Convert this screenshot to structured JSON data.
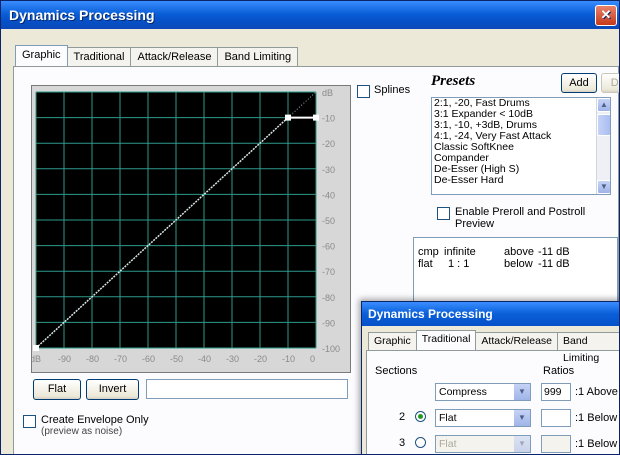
{
  "window": {
    "title": "Dynamics Processing",
    "close": "✕"
  },
  "tabs": [
    "Graphic",
    "Traditional",
    "Attack/Release",
    "Band Limiting"
  ],
  "graph": {
    "right_labels": [
      "dB",
      "-10",
      "-20",
      "-30",
      "-40",
      "-50",
      "-60",
      "-70",
      "-80",
      "-90",
      "-100"
    ],
    "bottom_labels": [
      "dB",
      "-90",
      "-80",
      "-70",
      "-60",
      "-50",
      "-40",
      "-30",
      "-20",
      "-10",
      "0"
    ],
    "curve_color": "#d9e6e6",
    "grid_color": "#2d9a8a",
    "background": "#000000"
  },
  "splines_label": "Splines",
  "buttons": {
    "flat": "Flat",
    "invert": "Invert"
  },
  "envelope": {
    "label": "Create Envelope Only",
    "sub": "(preview as noise)"
  },
  "presets": {
    "title": "Presets",
    "add": "Add",
    "del": "Del",
    "items": [
      "2:1, -20, Fast Drums",
      "3:1 Expander < 10dB",
      "3:1, -10, +3dB, Drums",
      "4:1, -24, Very Fast Attack",
      "Classic SoftKnee",
      "Compander",
      "De-Esser (High S)",
      "De-Esser Hard"
    ],
    "selected_index": 0,
    "preview_label": "Enable Preroll and Postroll",
    "preview_label2": "Preview"
  },
  "info": {
    "row1": [
      "cmp",
      "infinite",
      "above",
      "-11 dB"
    ],
    "row2": [
      "flat",
      "1 : 1",
      "below",
      "-11 dB"
    ]
  },
  "overlay": {
    "title": "Dynamics Processing",
    "tabs": [
      "Graphic",
      "Traditional",
      "Attack/Release",
      "Band Limiting"
    ],
    "sections_label": "Sections",
    "ratios_label": "Ratios",
    "rows": [
      {
        "num": "",
        "select": "Compress",
        "ratio": "999",
        "suffix": ":1 Above"
      },
      {
        "num": "2",
        "select": "Flat",
        "ratio": "",
        "suffix": ":1 Below"
      },
      {
        "num": "3",
        "select": "Flat",
        "ratio": "",
        "suffix": ":1 Below"
      }
    ]
  }
}
